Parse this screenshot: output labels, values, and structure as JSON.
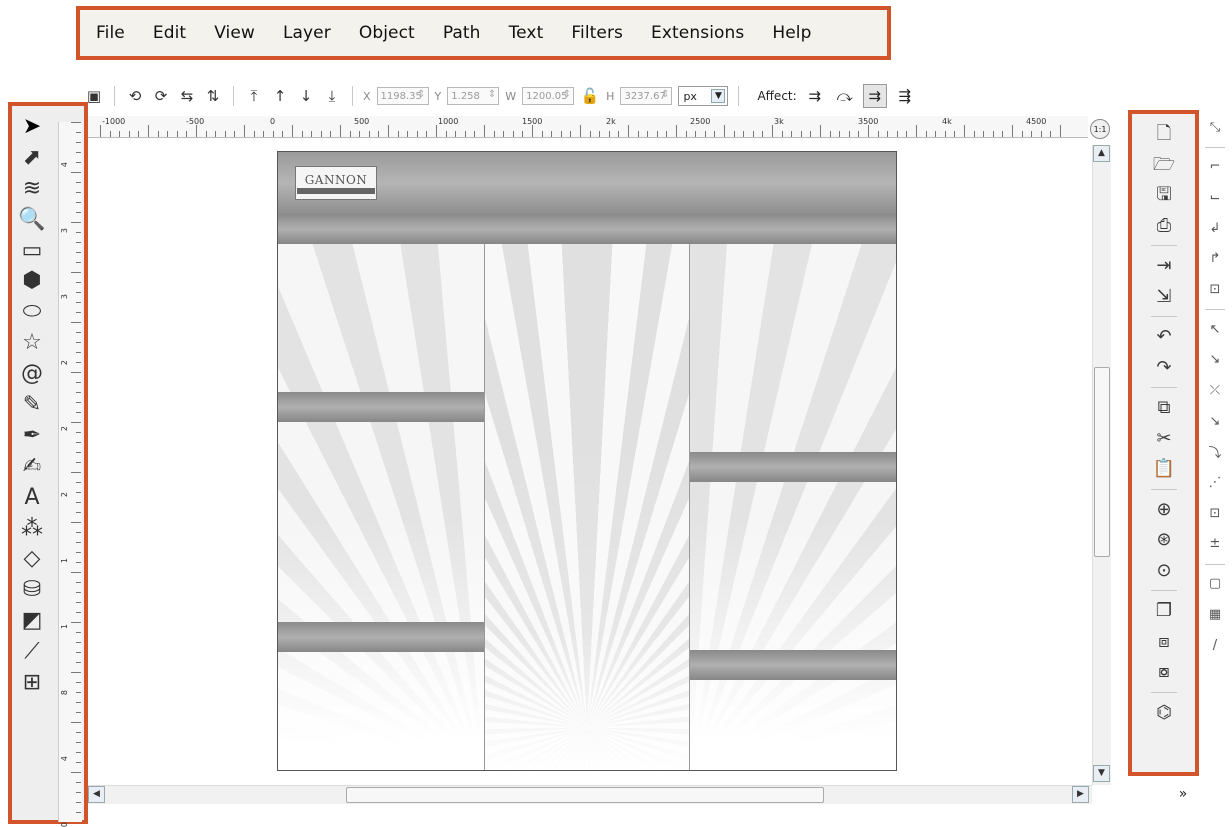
{
  "menubar": {
    "items": [
      "File",
      "Edit",
      "View",
      "Layer",
      "Object",
      "Path",
      "Text",
      "Filters",
      "Extensions",
      "Help"
    ]
  },
  "controls": {
    "x_label": "X",
    "x_value": "1198.35",
    "y_label": "Y",
    "y_value": "1.258",
    "w_label": "W",
    "w_value": "1200.05",
    "h_label": "H",
    "h_value": "3237.67",
    "unit": "px",
    "affect_label": "Affect:"
  },
  "ruler": {
    "h_labels": [
      "-1000",
      "-500",
      "0",
      "500",
      "1000",
      "1500",
      "2k",
      "2500",
      "3k",
      "3500",
      "4k",
      "4500"
    ],
    "v_labels": [
      "4",
      "3",
      "3",
      "2",
      "2",
      "2",
      "1",
      "1",
      "8",
      "4",
      "0"
    ],
    "zoom_label": "1:1"
  },
  "canvas": {
    "logo_text": "GANNON",
    "logo_subtext": "UNIVERSITY"
  },
  "tools": [
    {
      "name": "selector-tool-icon",
      "glyph": "➤"
    },
    {
      "name": "node-tool-icon",
      "glyph": "⬈"
    },
    {
      "name": "tweak-tool-icon",
      "glyph": "≋"
    },
    {
      "name": "zoom-tool-icon",
      "glyph": "🔍"
    },
    {
      "name": "rectangle-tool-icon",
      "glyph": "▭"
    },
    {
      "name": "3d-box-tool-icon",
      "glyph": "⬢"
    },
    {
      "name": "ellipse-tool-icon",
      "glyph": "⬭"
    },
    {
      "name": "star-tool-icon",
      "glyph": "☆"
    },
    {
      "name": "spiral-tool-icon",
      "glyph": "@"
    },
    {
      "name": "pencil-tool-icon",
      "glyph": "✎"
    },
    {
      "name": "pen-tool-icon",
      "glyph": "✒"
    },
    {
      "name": "calligraphy-tool-icon",
      "glyph": "✍"
    },
    {
      "name": "text-tool-icon",
      "glyph": "A"
    },
    {
      "name": "spray-tool-icon",
      "glyph": "⁂"
    },
    {
      "name": "eraser-tool-icon",
      "glyph": "◇"
    },
    {
      "name": "paint-bucket-tool-icon",
      "glyph": "⛁"
    },
    {
      "name": "gradient-tool-icon",
      "glyph": "◩"
    },
    {
      "name": "dropper-tool-icon",
      "glyph": "⟋"
    },
    {
      "name": "connector-tool-icon",
      "glyph": "⊞"
    }
  ],
  "commands": [
    {
      "name": "new-document-icon",
      "glyph": "🗋"
    },
    {
      "name": "open-file-icon",
      "glyph": "🗁"
    },
    {
      "name": "save-icon",
      "glyph": "🖫"
    },
    {
      "name": "print-icon",
      "glyph": "⎙"
    },
    {
      "sep": true
    },
    {
      "name": "import-icon",
      "glyph": "⇥"
    },
    {
      "name": "export-icon",
      "glyph": "⇲"
    },
    {
      "sep": true
    },
    {
      "name": "undo-icon",
      "glyph": "↶"
    },
    {
      "name": "redo-icon",
      "glyph": "↷"
    },
    {
      "sep": true
    },
    {
      "name": "copy-icon",
      "glyph": "⧉"
    },
    {
      "name": "cut-icon",
      "glyph": "✂"
    },
    {
      "name": "paste-icon",
      "glyph": "📋"
    },
    {
      "sep": true
    },
    {
      "name": "zoom-selection-icon",
      "glyph": "⊕"
    },
    {
      "name": "zoom-drawing-icon",
      "glyph": "⊛"
    },
    {
      "name": "zoom-page-icon",
      "glyph": "⊙"
    },
    {
      "sep": true
    },
    {
      "name": "duplicate-icon",
      "glyph": "❐"
    },
    {
      "name": "clone-icon",
      "glyph": "⧈"
    },
    {
      "name": "unlink-clone-icon",
      "glyph": "⧇"
    },
    {
      "sep": true
    },
    {
      "name": "xml-editor-icon",
      "glyph": "⌬"
    }
  ],
  "snaps": [
    {
      "name": "snap-toggle-icon",
      "glyph": "⤡"
    },
    {
      "sep": true
    },
    {
      "name": "snap-bbox-icon",
      "glyph": "⌐"
    },
    {
      "name": "snap-bbox-edges-icon",
      "glyph": "⌙"
    },
    {
      "name": "snap-bbox-corners-icon",
      "glyph": "↲"
    },
    {
      "name": "snap-bbox-midpoints-icon",
      "glyph": "↱"
    },
    {
      "name": "snap-bbox-centers-icon",
      "glyph": "⊡"
    },
    {
      "sep": true
    },
    {
      "name": "snap-nodes-icon",
      "glyph": "↖"
    },
    {
      "name": "snap-paths-icon",
      "glyph": "↘"
    },
    {
      "name": "snap-path-intersections-icon",
      "glyph": "⤫"
    },
    {
      "name": "snap-cusp-nodes-icon",
      "glyph": "↘"
    },
    {
      "name": "snap-smooth-nodes-icon",
      "glyph": "⤵"
    },
    {
      "name": "snap-midpoints-icon",
      "glyph": "⋰"
    },
    {
      "name": "snap-object-centers-icon",
      "glyph": "⊡"
    },
    {
      "name": "snap-rotation-centers-icon",
      "glyph": "±"
    },
    {
      "sep": true
    },
    {
      "name": "snap-page-border-icon",
      "glyph": "▢"
    },
    {
      "name": "snap-grid-icon",
      "glyph": "▦"
    },
    {
      "name": "snap-guides-icon",
      "glyph": "/"
    }
  ],
  "colors": {
    "highlight": "#d2542a",
    "chrome": "#eeeeee"
  }
}
